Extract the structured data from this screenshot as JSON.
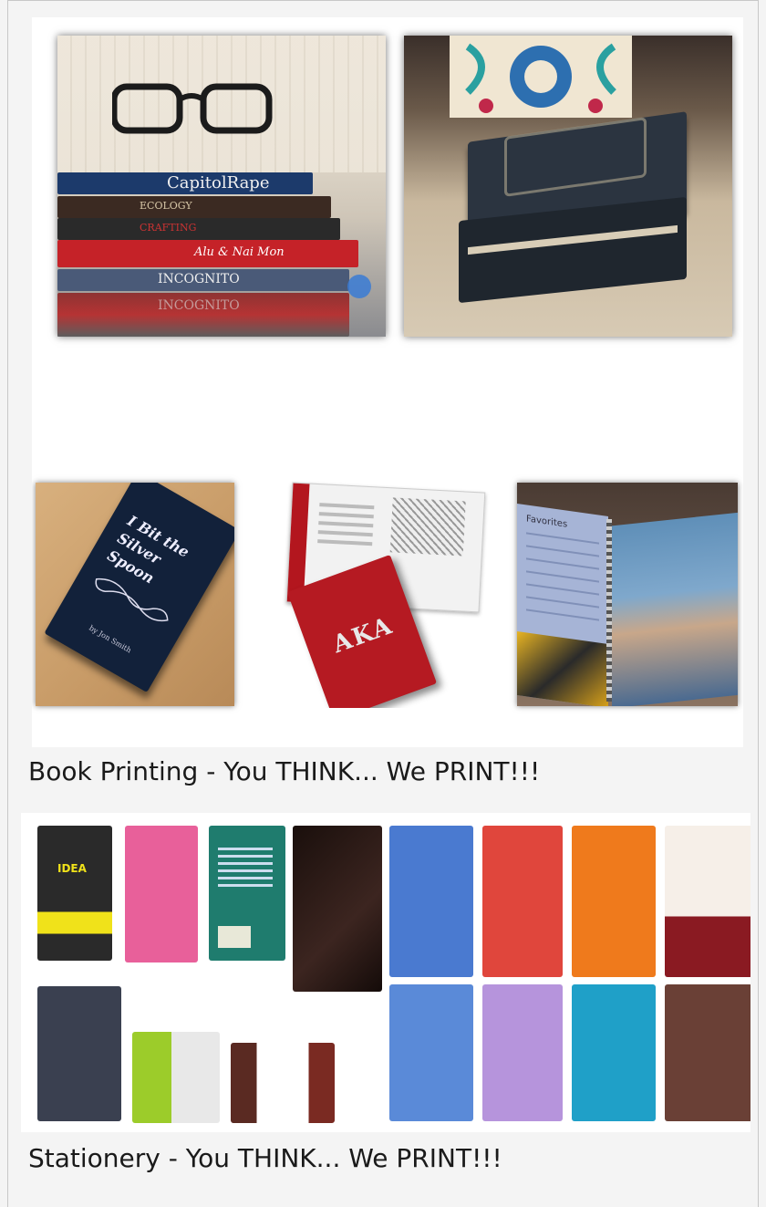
{
  "products": [
    {
      "caption": "Book Printing - You THINK... We PRINT!!!",
      "photo_texts": {
        "stack_top": "CapitolRape",
        "stack_b2": "ECOLOGY",
        "stack_b3": "CRAFTING",
        "stack_b4": "Alu & Nai Mon",
        "stack_b5": "INCOGNITO",
        "stack_b6": "INCOGNITO",
        "book_title": "I Bit the Silver Spoon",
        "book_author": "by Jon Smith",
        "aka": "AKA",
        "spiral_header": "Favorites"
      }
    },
    {
      "caption": "Stationery - You THINK... We PRINT!!!",
      "photo_texts": {
        "notebook1": "IDEA"
      }
    }
  ],
  "colors": {
    "page_bg": "#f4f4f4",
    "frame_border": "#c8c8c8",
    "caption_text": "#1a1a1a"
  }
}
